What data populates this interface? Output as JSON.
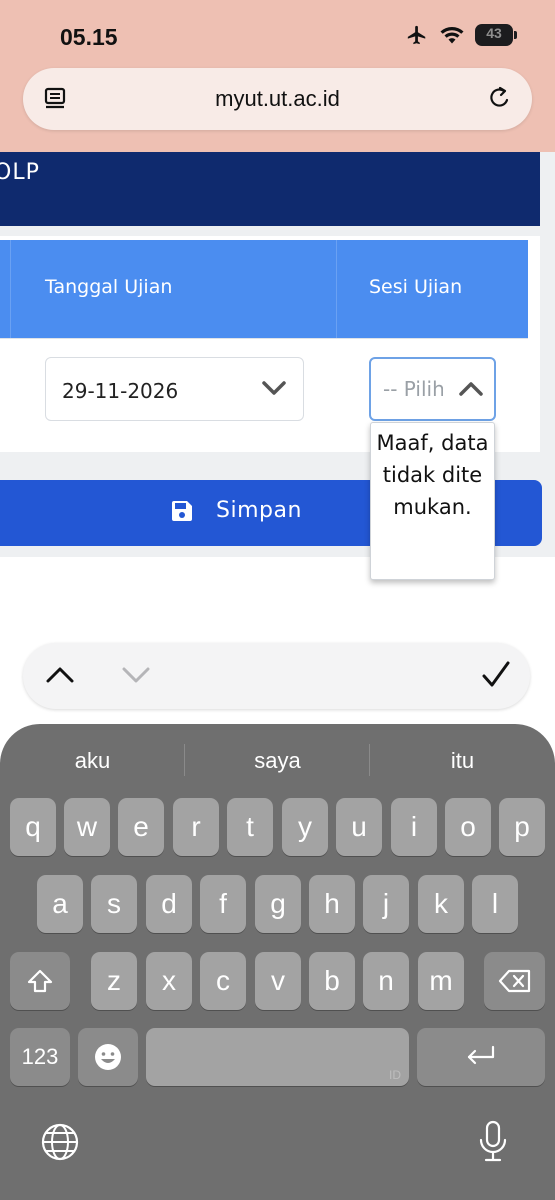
{
  "status_bar": {
    "time": "05.15",
    "battery": "43"
  },
  "browser": {
    "url": "myut.ut.ac.id"
  },
  "page": {
    "header_partial_text": "OLP",
    "table": {
      "columns": [
        "Tanggal Ujian",
        "Sesi Ujian"
      ],
      "date_value": "29-11-2026",
      "session_placeholder": "-- Pilih"
    },
    "dropdown_message": "Maaf, data tidak ditemukan.",
    "save_label": "Simpan"
  },
  "keyboard": {
    "suggestions": [
      "aku",
      "saya",
      "itu"
    ],
    "row1": [
      "q",
      "w",
      "e",
      "r",
      "t",
      "y",
      "u",
      "i",
      "o",
      "p"
    ],
    "row2": [
      "a",
      "s",
      "d",
      "f",
      "g",
      "h",
      "j",
      "k",
      "l"
    ],
    "row3": [
      "z",
      "x",
      "c",
      "v",
      "b",
      "n",
      "m"
    ],
    "numbers_label": "123",
    "space_language": "ID"
  },
  "colors": {
    "status_bg": "#eec0b3",
    "navy": "#0f2a6e",
    "table_header": "#4b8df0",
    "primary_button": "#2357d4",
    "keyboard_bg": "#6f6f6f"
  }
}
